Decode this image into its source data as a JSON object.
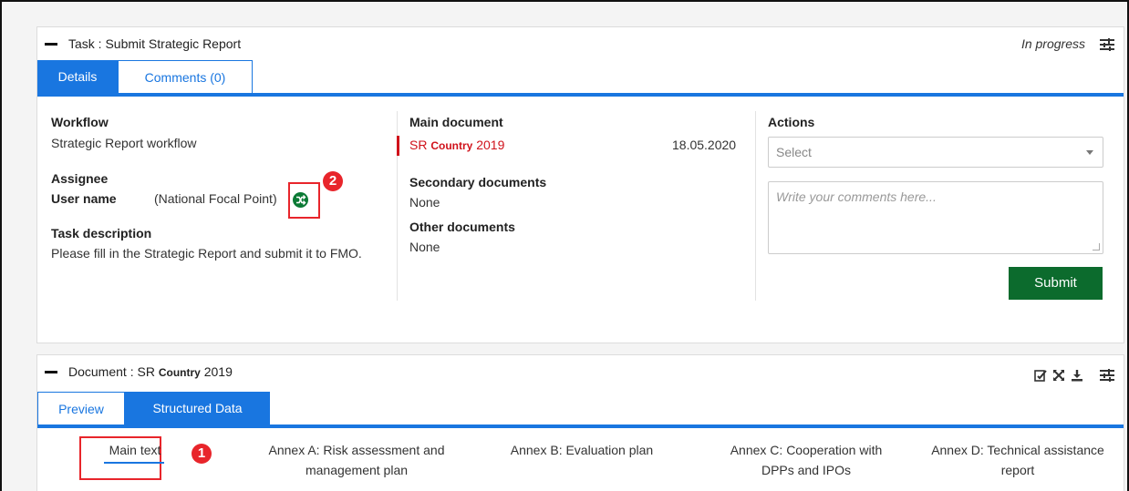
{
  "task_panel": {
    "title_prefix": "Task :",
    "title": "Submit Strategic Report",
    "status": "In progress",
    "tabs": [
      {
        "label": "Details",
        "active": true
      },
      {
        "label": "Comments (0)",
        "active": false
      }
    ],
    "workflow": {
      "label": "Workflow",
      "value": "Strategic Report workflow"
    },
    "assignee": {
      "label": "Assignee",
      "user": "User name",
      "role": "(National Focal Point)"
    },
    "task_description": {
      "label": "Task description",
      "value": "Please fill in the Strategic Report and submit it to FMO."
    },
    "main_document": {
      "label": "Main document",
      "prefix": "SR",
      "country": "Country",
      "year": "2019",
      "date": "18.05.2020"
    },
    "secondary_documents": {
      "label": "Secondary documents",
      "value": "None"
    },
    "other_documents": {
      "label": "Other documents",
      "value": "None"
    },
    "actions": {
      "label": "Actions",
      "select_value": "Select",
      "comment_placeholder": "Write your comments here...",
      "submit_label": "Submit"
    }
  },
  "document_panel": {
    "title_prefix": "Document :",
    "title_sr": "SR",
    "title_country": "Country",
    "title_year": "2019",
    "tabs": [
      {
        "label": "Preview",
        "active": false
      },
      {
        "label": "Structured Data",
        "active": true
      }
    ],
    "subtabs": [
      {
        "line1": "Main text",
        "line2": ""
      },
      {
        "line1": "Annex A: Risk assessment and",
        "line2": "management plan"
      },
      {
        "line1": "Annex B: Evaluation plan",
        "line2": ""
      },
      {
        "line1": "Annex C: Cooperation with",
        "line2": "DPPs and IPOs"
      },
      {
        "line1": "Annex D: Technical assistance",
        "line2": "report"
      }
    ]
  },
  "annotations": {
    "badge1": "1",
    "badge2": "2"
  },
  "colors": {
    "primary": "#1976e0",
    "submit": "#0c6b2d",
    "highlight": "#e8252b",
    "document_red": "#d0121b"
  }
}
